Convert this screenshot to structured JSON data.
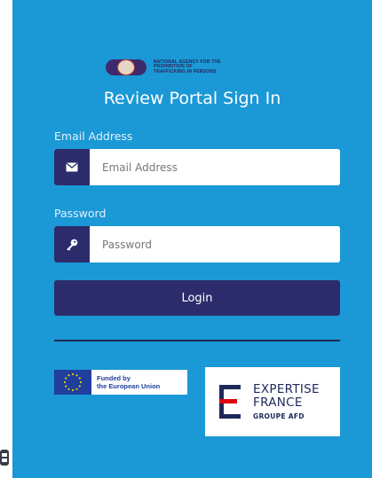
{
  "header": {
    "agency_text": "NATIONAL AGENCY FOR THE\nPROHIBITION OF\nTRAFFICKING IN PERSONS",
    "title": "Review Portal Sign In"
  },
  "form": {
    "email_label": "Email Address",
    "email_placeholder": "Email Address",
    "email_icon": "envelope-icon",
    "password_label": "Password",
    "password_placeholder": "Password",
    "password_icon": "key-icon",
    "login_label": "Login"
  },
  "partners": {
    "eu_line1": "Funded by",
    "eu_line2": "the European Union",
    "ef_line1": "EXPERTISE",
    "ef_line2": "FRANCE",
    "ef_line3": "GROUPE AFD"
  },
  "colors": {
    "background": "#1b98d6",
    "accent_dark": "#2c2c6c",
    "white": "#ffffff"
  }
}
